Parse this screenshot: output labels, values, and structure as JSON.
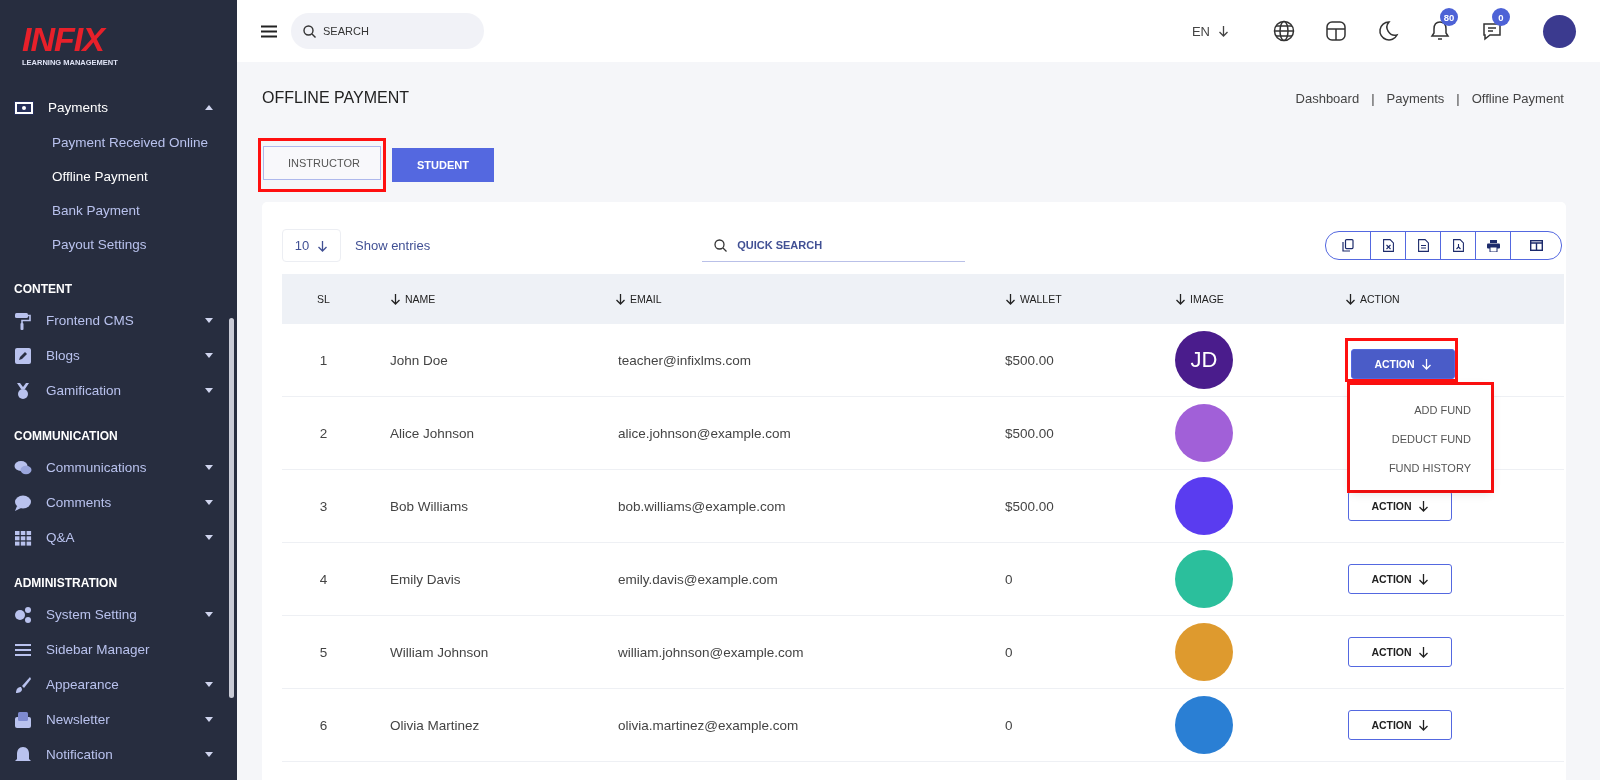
{
  "sidebar": {
    "logo": {
      "name": "INFIX",
      "tagline": "LEARNING MANAGEMENT"
    },
    "top_item": {
      "label": "Payments",
      "expanded": true,
      "children": [
        {
          "label": "Payment Received Online",
          "selected": false
        },
        {
          "label": "Offline Payment",
          "selected": true
        },
        {
          "label": "Bank Payment",
          "selected": false
        },
        {
          "label": "Payout Settings",
          "selected": false
        }
      ]
    },
    "sections": [
      {
        "heading": "CONTENT",
        "items": [
          {
            "label": "Frontend CMS",
            "kind": "menu",
            "expanded": false
          },
          {
            "label": "Blogs",
            "kind": "menu",
            "expanded": false
          },
          {
            "label": "Gamification",
            "kind": "menu",
            "expanded": false
          }
        ]
      },
      {
        "heading": "COMMUNICATION",
        "items": [
          {
            "label": "Communications",
            "kind": "menu",
            "expanded": false
          },
          {
            "label": "Comments",
            "kind": "menu",
            "expanded": false
          },
          {
            "label": "Q&A",
            "kind": "menu",
            "expanded": false
          }
        ]
      },
      {
        "heading": "ADMINISTRATION",
        "items": [
          {
            "label": "System Setting",
            "kind": "menu",
            "expanded": false
          },
          {
            "label": "Sidebar Manager",
            "kind": "link"
          },
          {
            "label": "Appearance",
            "kind": "menu",
            "expanded": false
          },
          {
            "label": "Newsletter",
            "kind": "menu",
            "expanded": false
          },
          {
            "label": "Notification",
            "kind": "menu",
            "expanded": false
          }
        ]
      }
    ]
  },
  "header": {
    "search": {
      "placeholder": "SEARCH"
    },
    "language": "EN",
    "notifications_badge": "80",
    "messages_badge": "0"
  },
  "page": {
    "title": "OFFLINE PAYMENT",
    "breadcrumb": {
      "separator": "|",
      "items": [
        "Dashboard",
        "Payments",
        "Offline Payment"
      ]
    }
  },
  "tabs": [
    {
      "label": "INSTRUCTOR",
      "selected": true,
      "highlighted": true
    },
    {
      "label": "STUDENT",
      "selected": false,
      "highlighted": false
    }
  ],
  "table": {
    "page_size": "10",
    "page_size_label": "Show entries",
    "search": {
      "placeholder": "QUICK SEARCH"
    },
    "columns": [
      {
        "label": "SL",
        "sortable": false
      },
      {
        "label": "NAME",
        "sortable": true
      },
      {
        "label": "EMAIL",
        "sortable": true
      },
      {
        "label": "WALLET",
        "sortable": true
      },
      {
        "label": "IMAGE",
        "sortable": true
      },
      {
        "label": "ACTION",
        "sortable": true
      }
    ],
    "rows": [
      {
        "sl": "1",
        "name": "John Doe",
        "email": "teacher@infixlms.com",
        "wallet": "$500.00",
        "image": {
          "kind": "initials",
          "text": "JD",
          "color": "#4a1c8c"
        },
        "action": {
          "label": "ACTION",
          "expanded": true,
          "highlighted": true,
          "menu": [
            "ADD FUND",
            "DEDUCT FUND",
            "FUND HISTORY"
          ]
        }
      },
      {
        "sl": "2",
        "name": "Alice Johnson",
        "email": "alice.johnson@example.com",
        "wallet": "$500.00",
        "image": {
          "kind": "photo",
          "color": "#a160d8"
        }
      },
      {
        "sl": "3",
        "name": "Bob Williams",
        "email": "bob.williams@example.com",
        "wallet": "$500.00",
        "image": {
          "kind": "photo",
          "color": "#5a3cf0"
        },
        "action": {
          "label": "ACTION",
          "expanded": false,
          "highlighted": false
        }
      },
      {
        "sl": "4",
        "name": "Emily Davis",
        "email": "emily.davis@example.com",
        "wallet": "0",
        "image": {
          "kind": "photo",
          "color": "#2bbf9c"
        },
        "action": {
          "label": "ACTION",
          "expanded": false,
          "highlighted": false
        }
      },
      {
        "sl": "5",
        "name": "William Johnson",
        "email": "william.johnson@example.com",
        "wallet": "0",
        "image": {
          "kind": "photo",
          "color": "#de9a2e"
        },
        "action": {
          "label": "ACTION",
          "expanded": false,
          "highlighted": false
        }
      },
      {
        "sl": "6",
        "name": "Olivia Martinez",
        "email": "olivia.martinez@example.com",
        "wallet": "0",
        "image": {
          "kind": "photo",
          "color": "#2a7fd4"
        },
        "action": {
          "label": "ACTION",
          "expanded": false,
          "highlighted": false
        }
      }
    ]
  }
}
